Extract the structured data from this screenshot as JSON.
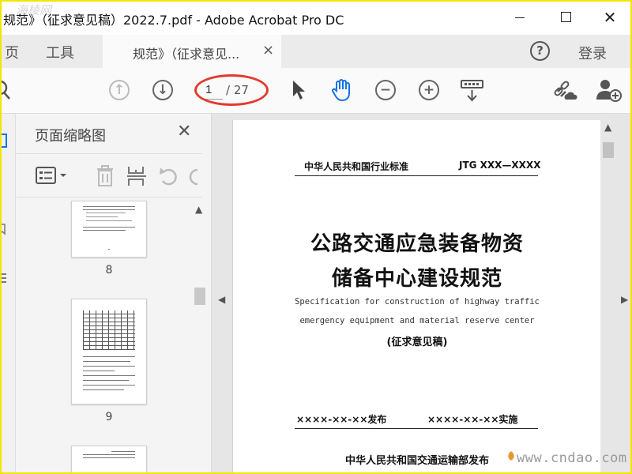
{
  "window": {
    "title": "规范》（征求意见稿）2022.7.pdf - Adobe Acrobat Pro DC",
    "watermark": "海棱网"
  },
  "tabs": {
    "home": "页",
    "tools": "工具",
    "document": "规范》（征求意见...",
    "close_glyph": "×"
  },
  "header": {
    "help_glyph": "?",
    "login": "登录"
  },
  "toolbar": {
    "page_current": "1",
    "page_total": "/ 27"
  },
  "thumbnail_panel": {
    "title": "页面缩略图",
    "close_glyph": "✕",
    "thumbnails": [
      {
        "label": "8"
      },
      {
        "label": "9"
      }
    ]
  },
  "document": {
    "standard_category": "中华人民共和国行业标准",
    "standard_number": "JTG XXX—XXXX",
    "title_line1": "公路交通应急装备物资",
    "title_line2": "储备中心建设规范",
    "subtitle_line1": "Specification for construction of highway traffic",
    "subtitle_line2": "emergency equipment and material reserve center",
    "draft_label": "(征求意见稿)",
    "publish_date": "××××-××-××发布",
    "effective_date": "××××-××-××实施",
    "publisher": "中华人民共和国交通运输部发布"
  },
  "site_watermark": "www.cndao.com",
  "colors": {
    "frame": "#f2e600",
    "annotation": "#e23b2e",
    "hand_tool": "#1473e6"
  }
}
